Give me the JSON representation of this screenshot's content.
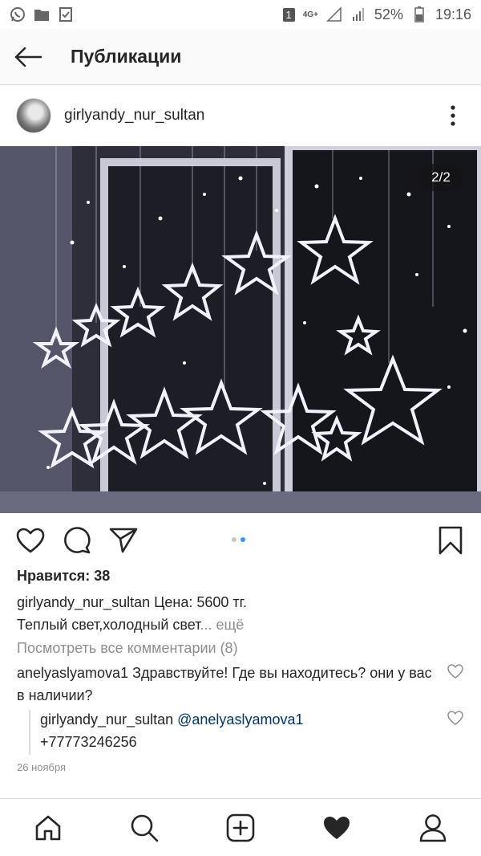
{
  "status_bar": {
    "left_icons": [
      "whatsapp-icon",
      "folder-icon",
      "checklist-icon"
    ],
    "sim_badge": "1",
    "network": "4G+",
    "battery_percent": "52%",
    "time": "19:16"
  },
  "appbar": {
    "title": "Публикации"
  },
  "post": {
    "username": "girlyandy_nur_sultan",
    "image_counter": "2/2",
    "carousel": {
      "count": 2,
      "active_index": 1
    },
    "likes": "Нравится: 38",
    "caption_username": "girlyandy_nur_sultan",
    "caption_text_1": " Цена: 5600 тг.",
    "caption_text_2": "Теплый свет,холодный свет",
    "caption_more": "... ещё",
    "view_comments": "Посмотреть все комментарии (8)",
    "comment": {
      "username": "anelyaslyamova1",
      "text": " Здравствуйте! Где вы находитесь? они у вас в наличии?"
    },
    "reply": {
      "username": "girlyandy_nur_sultan",
      "mention": "@anelyaslyamova1",
      "text": "+77773246256"
    },
    "date": "26 ноября"
  },
  "colors": {
    "text": "#262626",
    "muted": "#8e8e8e",
    "accent_dot": "#3897f0",
    "mention": "#003569"
  }
}
